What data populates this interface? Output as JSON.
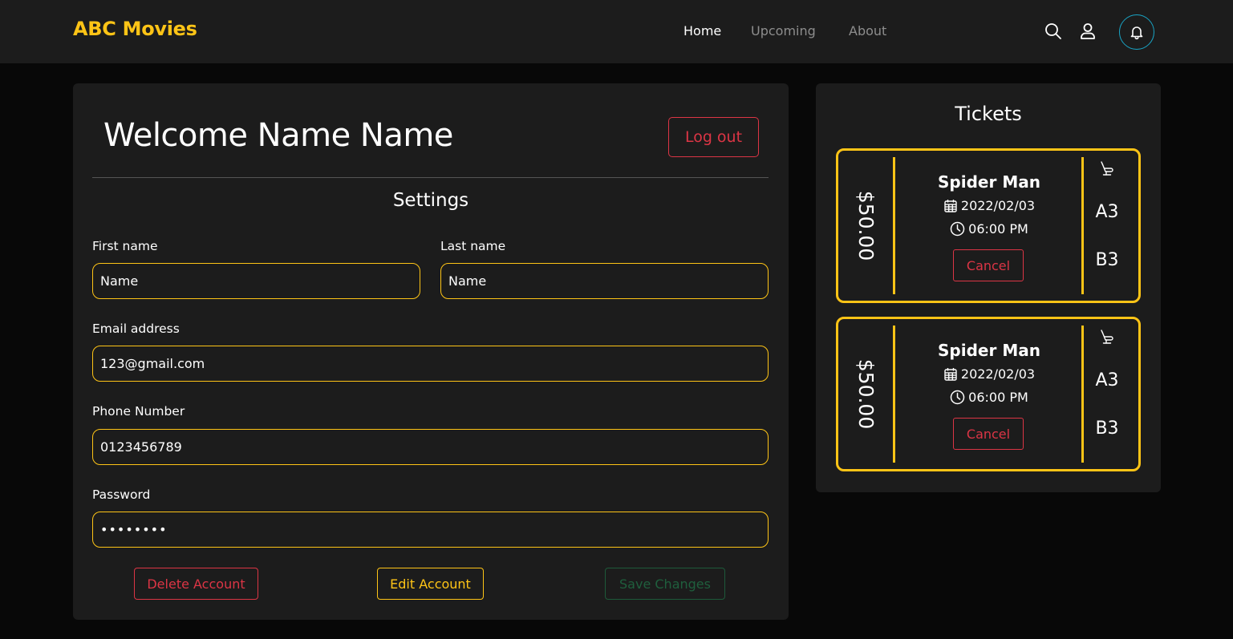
{
  "header": {
    "brand": "ABC Movies",
    "nav": [
      {
        "label": "Home",
        "active": true
      },
      {
        "label": "Upcoming",
        "active": false
      },
      {
        "label": "About",
        "active": false
      }
    ],
    "icons": [
      "search-icon",
      "user-icon",
      "bell-icon"
    ]
  },
  "settings": {
    "welcome": "Welcome Name Name",
    "logout_label": "Log out",
    "title": "Settings",
    "fields": {
      "first_name": {
        "label": "First name",
        "value": "Name"
      },
      "last_name": {
        "label": "Last name",
        "value": "Name"
      },
      "email": {
        "label": "Email address",
        "value": "123@gmail.com"
      },
      "phone": {
        "label": "Phone Number",
        "value": "0123456789"
      },
      "password": {
        "label": "Password",
        "value": "••••••••"
      }
    },
    "buttons": {
      "delete": "Delete Account",
      "edit": "Edit Account",
      "save": "Save Changes"
    }
  },
  "tickets": {
    "title": "Tickets",
    "items": [
      {
        "price": "$50.00",
        "movie": "Spider Man",
        "date": "2022/02/03",
        "time": "06:00 PM",
        "cancel_label": "Cancel",
        "seats": [
          "A3",
          "B3"
        ]
      },
      {
        "price": "$50.00",
        "movie": "Spider Man",
        "date": "2022/02/03",
        "time": "06:00 PM",
        "cancel_label": "Cancel",
        "seats": [
          "A3",
          "B3"
        ]
      }
    ]
  },
  "colors": {
    "accent": "#fec416",
    "danger": "#dc3545",
    "success_muted": "#1f5f3d",
    "bell_ring": "#19a5c6",
    "panel": "#1c1c1c",
    "background": "#080808"
  }
}
